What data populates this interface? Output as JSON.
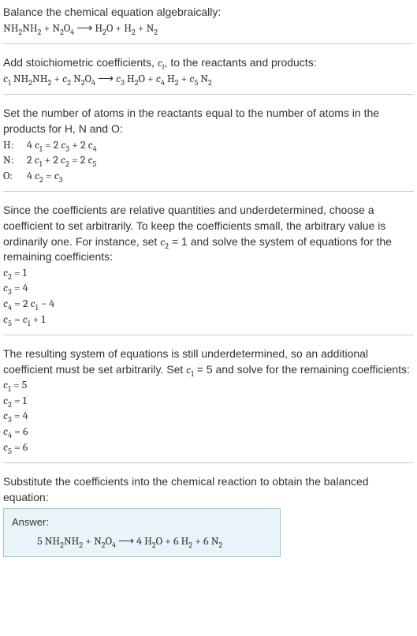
{
  "s1": {
    "line1": "Balance the chemical equation algebraically:",
    "eq_parts": {
      "a": "NH",
      "b": "2",
      "c": "NH",
      "d": "2",
      "e": " + N",
      "f": "2",
      "g": "O",
      "h": "4",
      "i": " ⟶ H",
      "j": "2",
      "k": "O + H",
      "l": "2",
      "m": " + N",
      "n": "2"
    }
  },
  "s2": {
    "line1_a": "Add stoichiometric coefficients, ",
    "line1_c": "c",
    "line1_i": "i",
    "line1_b": ", to the reactants and products:",
    "eq": {
      "c1": "c",
      "i1": "1",
      "sp1": " NH",
      "s1": "2",
      "nh": "NH",
      "s2": "2",
      "plus1": " + ",
      "c2": "c",
      "i2": "2",
      "sp2": " N",
      "s3": "2",
      "o": "O",
      "s4": "4",
      "arrow": " ⟶ ",
      "c3": "c",
      "i3": "3",
      "sp3": " H",
      "s5": "2",
      "oo": "O + ",
      "c4": "c",
      "i4": "4",
      "sp4": " H",
      "s6": "2",
      "plus3": " + ",
      "c5": "c",
      "i5": "5",
      "sp5": " N",
      "s7": "2"
    }
  },
  "s3": {
    "line1": "Set the number of atoms in the reactants equal to the number of atoms in the products for H, N and O:",
    "rows": [
      {
        "el": "H:",
        "lhs_a": "4 ",
        "c": "c",
        "i": "1",
        "mid": " = 2 ",
        "c2": "c",
        "i2": "3",
        "plus": " + 2 ",
        "c3": "c",
        "i3": "4"
      },
      {
        "el": "N:",
        "lhs_a": "2 ",
        "c": "c",
        "i": "1",
        "mid": " + 2 ",
        "c2": "c",
        "i2": "2",
        "eq": " = 2 ",
        "c3": "c",
        "i3": "5"
      },
      {
        "el": "O:",
        "lhs_a": "4 ",
        "c": "c",
        "i": "2",
        "mid": " = ",
        "c2": "c",
        "i2": "3"
      }
    ]
  },
  "s4": {
    "p_a": "Since the coefficients are relative quantities and underdetermined, choose a coefficient to set arbitrarily. To keep the coefficients small, the arbitrary value is ordinarily one. For instance, set ",
    "p_c": "c",
    "p_i": "2",
    "p_b": " = 1 and solve the system of equations for the remaining coefficients:",
    "rows": [
      {
        "c": "c",
        "i": "2",
        "rhs": " = 1"
      },
      {
        "c": "c",
        "i": "3",
        "rhs": " = 4"
      },
      {
        "c": "c",
        "i": "4",
        "pre": " = 2 ",
        "c2": "c",
        "i2": "1",
        "post": " − 4"
      },
      {
        "c": "c",
        "i": "5",
        "pre": " = ",
        "c2": "c",
        "i2": "1",
        "post": " + 1"
      }
    ]
  },
  "s5": {
    "p_a": "The resulting system of equations is still underdetermined, so an additional coefficient must be set arbitrarily. Set ",
    "p_c": "c",
    "p_i": "1",
    "p_b": " = 5 and solve for the remaining coefficients:",
    "rows": [
      {
        "c": "c",
        "i": "1",
        "rhs": " = 5"
      },
      {
        "c": "c",
        "i": "2",
        "rhs": " = 1"
      },
      {
        "c": "c",
        "i": "3",
        "rhs": " = 4"
      },
      {
        "c": "c",
        "i": "4",
        "rhs": " = 6"
      },
      {
        "c": "c",
        "i": "5",
        "rhs": " = 6"
      }
    ]
  },
  "s6": {
    "line1": "Substitute the coefficients into the chemical reaction to obtain the balanced equation:",
    "answer_label": "Answer:",
    "eq": {
      "a": "5 NH",
      "b": "2",
      "c": "NH",
      "d": "2",
      "e": " + N",
      "f": "2",
      "g": "O",
      "h": "4",
      "i": " ⟶ 4 H",
      "j": "2",
      "k": "O + 6 H",
      "l": "2",
      "m": " + 6 N",
      "n": "2"
    }
  }
}
